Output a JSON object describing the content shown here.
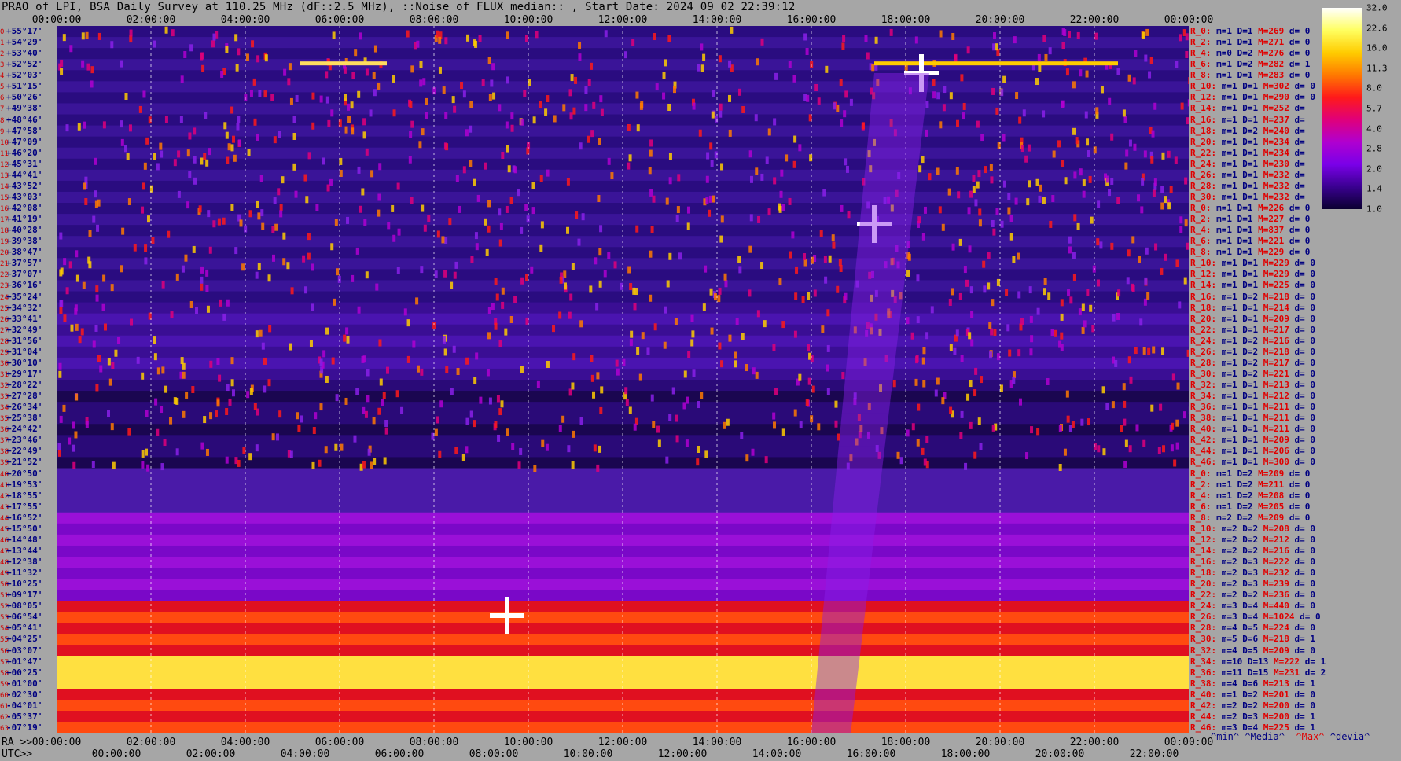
{
  "title": "PRAO of LPI, BSA Daily Survey at 110.25 MHz (dF::2.5 MHz), ::Noise_of_FLUX_median:: , Start Date: 2024 09 02 22:39:12",
  "chart_data": {
    "type": "heatmap",
    "title": "PRAO of LPI, BSA Daily Survey at 110.25 MHz (dF::2.5 MHz), ::Noise_of_FLUX_median:: , Start Date: 2024 09 02 22:39:12",
    "top_axis_ticks": [
      "00:00:00",
      "02:00:00",
      "04:00:00",
      "06:00:00",
      "08:00:00",
      "10:00:00",
      "12:00:00",
      "14:00:00",
      "16:00:00",
      "18:00:00",
      "20:00:00",
      "22:00:00",
      "00:00:00"
    ],
    "bottom_ra_prefix": "RA >>",
    "bottom_ra_ticks": [
      "00:00:00",
      "02:00:00",
      "04:00:00",
      "06:00:00",
      "08:00:00",
      "10:00:00",
      "12:00:00",
      "14:00:00",
      "16:00:00",
      "18:00:00",
      "20:00:00",
      "22:00:00",
      "00:00:00"
    ],
    "bottom_utc_prefix": "UTC>>",
    "bottom_utc_ticks": [
      "00:00:00",
      "02:00:00",
      "04:00:00",
      "06:00:00",
      "08:00:00",
      "10:00:00",
      "12:00:00",
      "14:00:00",
      "16:00:00",
      "18:00:00",
      "20:00:00",
      "22:00:00"
    ],
    "colorbar_ticks": [
      "32.0",
      "22.6",
      "16.0",
      "11.3",
      "8.0",
      "5.7",
      "4.0",
      "2.8",
      "2.0",
      "1.4",
      "1.0"
    ],
    "colorbar_colors": [
      "#ffffff",
      "#ffff60",
      "#ffcc00",
      "#ff7a00",
      "#ff1a1a",
      "#e0007a",
      "#b000d0",
      "#7a00e8",
      "#3a0090",
      "#0a0030"
    ],
    "declination_rows": [
      {
        "i": "0",
        "dec": "+55°17'"
      },
      {
        "i": "1",
        "dec": "+54°29'"
      },
      {
        "i": "2",
        "dec": "+53°40'"
      },
      {
        "i": "3",
        "dec": "+52°52'"
      },
      {
        "i": "4",
        "dec": "+52°03'"
      },
      {
        "i": "5",
        "dec": "+51°15'"
      },
      {
        "i": "6",
        "dec": "+50°26'"
      },
      {
        "i": "7",
        "dec": "+49°38'"
      },
      {
        "i": "8",
        "dec": "+48°46'"
      },
      {
        "i": "9",
        "dec": "+47°58'"
      },
      {
        "i": "10",
        "dec": "+47°09'"
      },
      {
        "i": "11",
        "dec": "+46°20'"
      },
      {
        "i": "12",
        "dec": "+45°31'"
      },
      {
        "i": "13",
        "dec": "+44°41'"
      },
      {
        "i": "14",
        "dec": "+43°52'"
      },
      {
        "i": "15",
        "dec": "+43°03'"
      },
      {
        "i": "16",
        "dec": "+42°08'"
      },
      {
        "i": "17",
        "dec": "+41°19'"
      },
      {
        "i": "18",
        "dec": "+40°28'"
      },
      {
        "i": "19",
        "dec": "+39°38'"
      },
      {
        "i": "20",
        "dec": "+38°47'"
      },
      {
        "i": "21",
        "dec": "+37°57'"
      },
      {
        "i": "22",
        "dec": "+37°07'"
      },
      {
        "i": "23",
        "dec": "+36°16'"
      },
      {
        "i": "24",
        "dec": "+35°24'"
      },
      {
        "i": "25",
        "dec": "+34°32'"
      },
      {
        "i": "26",
        "dec": "+33°41'"
      },
      {
        "i": "27",
        "dec": "+32°49'"
      },
      {
        "i": "28",
        "dec": "+31°56'"
      },
      {
        "i": "29",
        "dec": "+31°04'"
      },
      {
        "i": "30",
        "dec": "+30°10'"
      },
      {
        "i": "31",
        "dec": "+29°17'"
      },
      {
        "i": "32",
        "dec": "+28°22'"
      },
      {
        "i": "33",
        "dec": "+27°28'"
      },
      {
        "i": "34",
        "dec": "+26°34'"
      },
      {
        "i": "35",
        "dec": "+25°38'"
      },
      {
        "i": "36",
        "dec": "+24°42'"
      },
      {
        "i": "37",
        "dec": "+23°46'"
      },
      {
        "i": "38",
        "dec": "+22°49'"
      },
      {
        "i": "39",
        "dec": "+21°52'"
      },
      {
        "i": "40",
        "dec": "+20°50'"
      },
      {
        "i": "41",
        "dec": "+19°53'"
      },
      {
        "i": "42",
        "dec": "+18°55'"
      },
      {
        "i": "43",
        "dec": "+17°55'"
      },
      {
        "i": "44",
        "dec": "+16°52'"
      },
      {
        "i": "45",
        "dec": "+15°50'"
      },
      {
        "i": "46",
        "dec": "+14°48'"
      },
      {
        "i": "47",
        "dec": "+13°44'"
      },
      {
        "i": "48",
        "dec": "+12°38'"
      },
      {
        "i": "49",
        "dec": "+11°32'"
      },
      {
        "i": "50",
        "dec": "+10°25'"
      },
      {
        "i": "51",
        "dec": "+09°17'"
      },
      {
        "i": "52",
        "dec": "+08°05'"
      },
      {
        "i": "53",
        "dec": "+06°54'"
      },
      {
        "i": "54",
        "dec": "+05°41'"
      },
      {
        "i": "55",
        "dec": "+04°25'"
      },
      {
        "i": "56",
        "dec": "+03°07'"
      },
      {
        "i": "57",
        "dec": "+01°47'"
      },
      {
        "i": "58",
        "dec": "+00°25'"
      },
      {
        "i": "59",
        "dec": "-01°00'"
      },
      {
        "i": "60",
        "dec": "-02°30'"
      },
      {
        "i": "61",
        "dec": "-04°01'"
      },
      {
        "i": "62",
        "dec": "-05°37'"
      },
      {
        "i": "63",
        "dec": "-07°19'"
      }
    ],
    "row_stats": [
      {
        "r": "R_0:",
        "m": "m=1 D=1",
        "M": "M=269",
        "d": "d= 0"
      },
      {
        "r": "R_2:",
        "m": "m=1 D=1",
        "M": "M=271",
        "d": "d= 0"
      },
      {
        "r": "R_4:",
        "m": "m=0 D=2",
        "M": "M=276",
        "d": "d= 0"
      },
      {
        "r": "R_6:",
        "m": "m=1 D=2",
        "M": "M=282",
        "d": "d= 1"
      },
      {
        "r": "R_8:",
        "m": "m=1 D=1",
        "M": "M=283",
        "d": "d= 0"
      },
      {
        "r": "R_10:",
        "m": "m=1 D=1",
        "M": "M=302",
        "d": "d= 0"
      },
      {
        "r": "R_12:",
        "m": "m=1 D=1",
        "M": "M=290",
        "d": "d= 0"
      },
      {
        "r": "R_14:",
        "m": "m=1 D=1",
        "M": "M=252",
        "d": "d="
      },
      {
        "r": "R_16:",
        "m": "m=1 D=1",
        "M": "M=237",
        "d": "d="
      },
      {
        "r": "R_18:",
        "m": "m=1 D=2",
        "M": "M=240",
        "d": "d="
      },
      {
        "r": "R_20:",
        "m": "m=1 D=1",
        "M": "M=234",
        "d": "d="
      },
      {
        "r": "R_22:",
        "m": "m=1 D=1",
        "M": "M=234",
        "d": "d="
      },
      {
        "r": "R_24:",
        "m": "m=1 D=1",
        "M": "M=230",
        "d": "d="
      },
      {
        "r": "R_26:",
        "m": "m=1 D=1",
        "M": "M=232",
        "d": "d="
      },
      {
        "r": "R_28:",
        "m": "m=1 D=1",
        "M": "M=232",
        "d": "d="
      },
      {
        "r": "R_30:",
        "m": "m=1 D=1",
        "M": "M=232",
        "d": "d="
      },
      {
        "r": "R_0:",
        "m": "m=1 D=1",
        "M": "M=226",
        "d": "d= 0"
      },
      {
        "r": "R_2:",
        "m": "m=1 D=1",
        "M": "M=227",
        "d": "d= 0"
      },
      {
        "r": "R_4:",
        "m": "m=1 D=1",
        "M": "M=837",
        "d": "d= 0"
      },
      {
        "r": "R_6:",
        "m": "m=1 D=1",
        "M": "M=221",
        "d": "d= 0"
      },
      {
        "r": "R_8:",
        "m": "m=1 D=1",
        "M": "M=229",
        "d": "d= 0"
      },
      {
        "r": "R_10:",
        "m": "m=1 D=1",
        "M": "M=229",
        "d": "d= 0"
      },
      {
        "r": "R_12:",
        "m": "m=1 D=1",
        "M": "M=229",
        "d": "d= 0"
      },
      {
        "r": "R_14:",
        "m": "m=1 D=1",
        "M": "M=225",
        "d": "d= 0"
      },
      {
        "r": "R_16:",
        "m": "m=1 D=2",
        "M": "M=218",
        "d": "d= 0"
      },
      {
        "r": "R_18:",
        "m": "m=1 D=1",
        "M": "M=214",
        "d": "d= 0"
      },
      {
        "r": "R_20:",
        "m": "m=1 D=1",
        "M": "M=209",
        "d": "d= 0"
      },
      {
        "r": "R_22:",
        "m": "m=1 D=1",
        "M": "M=217",
        "d": "d= 0"
      },
      {
        "r": "R_24:",
        "m": "m=1 D=2",
        "M": "M=216",
        "d": "d= 0"
      },
      {
        "r": "R_26:",
        "m": "m=1 D=2",
        "M": "M=218",
        "d": "d= 0"
      },
      {
        "r": "R_28:",
        "m": "m=1 D=2",
        "M": "M=217",
        "d": "d= 0"
      },
      {
        "r": "R_30:",
        "m": "m=1 D=2",
        "M": "M=221",
        "d": "d= 0"
      },
      {
        "r": "R_32:",
        "m": "m=1 D=1",
        "M": "M=213",
        "d": "d= 0"
      },
      {
        "r": "R_34:",
        "m": "m=1 D=1",
        "M": "M=212",
        "d": "d= 0"
      },
      {
        "r": "R_36:",
        "m": "m=1 D=1",
        "M": "M=211",
        "d": "d= 0"
      },
      {
        "r": "R_38:",
        "m": "m=1 D=1",
        "M": "M=211",
        "d": "d= 0"
      },
      {
        "r": "R_40:",
        "m": "m=1 D=1",
        "M": "M=211",
        "d": "d= 0"
      },
      {
        "r": "R_42:",
        "m": "m=1 D=1",
        "M": "M=209",
        "d": "d= 0"
      },
      {
        "r": "R_44:",
        "m": "m=1 D=1",
        "M": "M=206",
        "d": "d= 0"
      },
      {
        "r": "R_46:",
        "m": "m=1 D=1",
        "M": "M=300",
        "d": "d= 0"
      },
      {
        "r": "R_0:",
        "m": "m=1 D=2",
        "M": "M=209",
        "d": "d= 0"
      },
      {
        "r": "R_2:",
        "m": "m=1 D=2",
        "M": "M=211",
        "d": "d= 0"
      },
      {
        "r": "R_4:",
        "m": "m=1 D=2",
        "M": "M=208",
        "d": "d= 0"
      },
      {
        "r": "R_6:",
        "m": "m=1 D=2",
        "M": "M=205",
        "d": "d= 0"
      },
      {
        "r": "R_8:",
        "m": "m=2 D=2",
        "M": "M=209",
        "d": "d= 0"
      },
      {
        "r": "R_10:",
        "m": "m=2 D=2",
        "M": "M=208",
        "d": "d= 0"
      },
      {
        "r": "R_12:",
        "m": "m=2 D=2",
        "M": "M=212",
        "d": "d= 0"
      },
      {
        "r": "R_14:",
        "m": "m=2 D=2",
        "M": "M=216",
        "d": "d= 0"
      },
      {
        "r": "R_16:",
        "m": "m=2 D=3",
        "M": "M=222",
        "d": "d= 0"
      },
      {
        "r": "R_18:",
        "m": "m=2 D=3",
        "M": "M=232",
        "d": "d= 0"
      },
      {
        "r": "R_20:",
        "m": "m=2 D=3",
        "M": "M=239",
        "d": "d= 0"
      },
      {
        "r": "R_22:",
        "m": "m=2 D=2",
        "M": "M=236",
        "d": "d= 0"
      },
      {
        "r": "R_24:",
        "m": "m=3 D=4",
        "M": "M=440",
        "d": "d= 0"
      },
      {
        "r": "R_26:",
        "m": "m=3 D=4",
        "M": "M=1024",
        "d": "d= 0"
      },
      {
        "r": "R_28:",
        "m": "m=4 D=5",
        "M": "M=224",
        "d": "d= 0"
      },
      {
        "r": "R_30:",
        "m": "m=5 D=6",
        "M": "M=218",
        "d": "d= 1"
      },
      {
        "r": "R_32:",
        "m": "m=4 D=5",
        "M": "M=209",
        "d": "d= 0"
      },
      {
        "r": "R_34:",
        "m": "m=10 D=13",
        "M": "M=222",
        "d": "d= 1"
      },
      {
        "r": "R_36:",
        "m": "m=11 D=15",
        "M": "M=231",
        "d": "d= 2"
      },
      {
        "r": "R_38:",
        "m": "m=4 D=6",
        "M": "M=213",
        "d": "d= 1"
      },
      {
        "r": "R_40:",
        "m": "m=1 D=2",
        "M": "M=201",
        "d": "d= 0"
      },
      {
        "r": "R_42:",
        "m": "m=2 D=2",
        "M": "M=200",
        "d": "d= 0"
      },
      {
        "r": "R_44:",
        "m": "m=2 D=3",
        "M": "M=200",
        "d": "d= 1"
      },
      {
        "r": "R_46:",
        "m": "m=3 D=4",
        "M": "M=225",
        "d": "d= 1"
      }
    ],
    "stat_legend": {
      "min": "^min^",
      "median": "^Media^",
      "max": "^Max^",
      "devia": "^devia^"
    }
  }
}
